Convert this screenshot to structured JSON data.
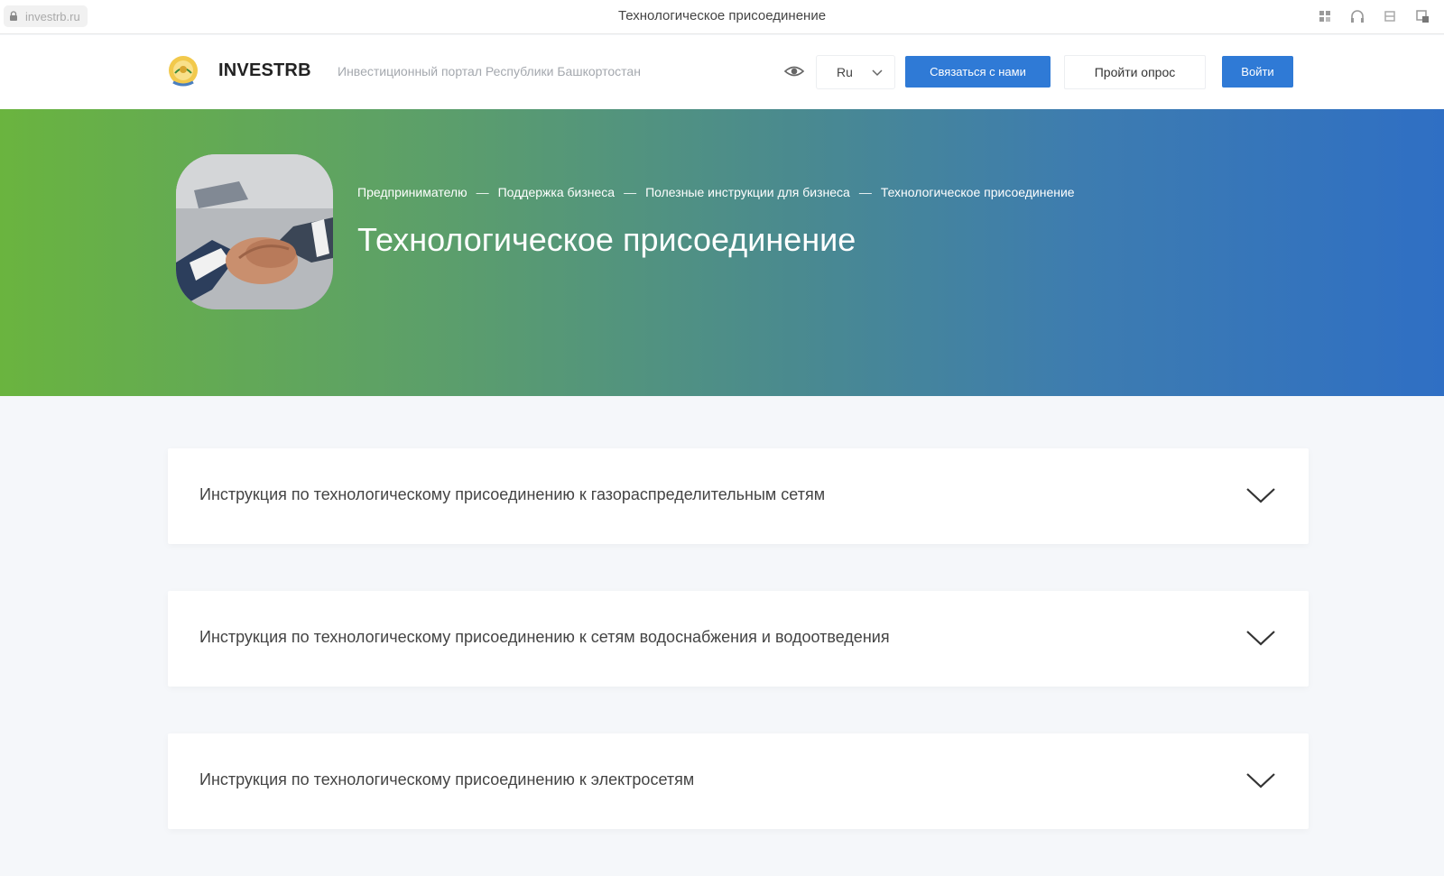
{
  "browser": {
    "address": "investrb.ru",
    "tab_title": "Технологическое присоединение"
  },
  "header": {
    "brand": "INVESTRB",
    "tagline": "Инвестиционный портал Республики Башкортостан",
    "language": "Ru",
    "contact_label": "Связаться с нами",
    "survey_label": "Пройти опрос",
    "login_label": "Войти"
  },
  "hero": {
    "breadcrumb": [
      "Предпринимателю",
      "Поддержка бизнеса",
      "Полезные инструкции для бизнеса",
      "Технологическое присоединение"
    ],
    "separator": "—",
    "title": "Технологическое присоединение"
  },
  "accordion": [
    {
      "label": "Инструкция по технологическому присоединению к газораспределительным сетям"
    },
    {
      "label": "Инструкция по технологическому присоединению к сетям водоснабжения и водоотведения"
    },
    {
      "label": "Инструкция по технологическому присоединению к электросетям"
    }
  ],
  "colors": {
    "accent": "#2f7ad6",
    "hero_start": "#6ab43f",
    "hero_end": "#2f6fc4"
  }
}
